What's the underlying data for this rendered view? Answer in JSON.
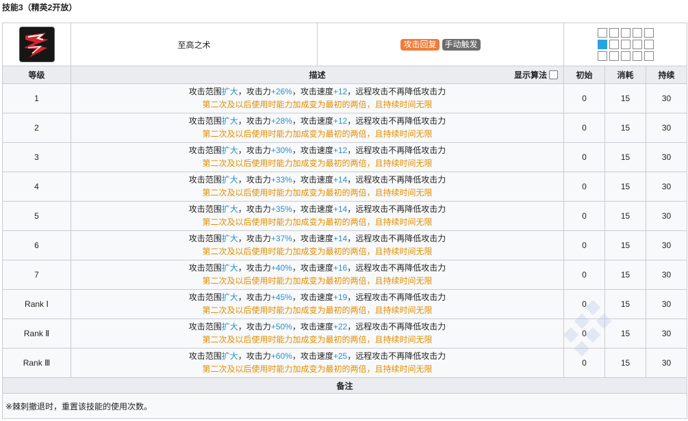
{
  "title": "技能3（精英2开放）",
  "skill": {
    "name": "至高之术",
    "tags": [
      {
        "label": "攻击回复",
        "color": "#f07c3b"
      },
      {
        "label": "手动触发",
        "color": "#6b6b6b"
      }
    ],
    "range_grid": [
      [
        0,
        0,
        0,
        0,
        0
      ],
      [
        1,
        0,
        0,
        0,
        0
      ],
      [
        0,
        0,
        0,
        0,
        0
      ]
    ]
  },
  "columns": {
    "level": "等级",
    "desc": "描述",
    "show_algo": "显示算法",
    "initial": "初始",
    "cost": "消耗",
    "duration": "持续"
  },
  "rows": [
    {
      "level": "1",
      "p1": "攻击范围",
      "p2": "扩大",
      "p3": "，攻击力",
      "p4": "+26%",
      "p5": "，攻击速度",
      "p6": "+12",
      "p7": "，远程攻击不再降低攻击力",
      "line2": "第二次及以后使用时能力加成变为最初的两倍，且持续时间无限",
      "initial": "0",
      "cost": "15",
      "duration": "30"
    },
    {
      "level": "2",
      "p1": "攻击范围",
      "p2": "扩大",
      "p3": "，攻击力",
      "p4": "+28%",
      "p5": "，攻击速度",
      "p6": "+12",
      "p7": "，远程攻击不再降低攻击力",
      "line2": "第二次及以后使用时能力加成变为最初的两倍，且持续时间无限",
      "initial": "0",
      "cost": "15",
      "duration": "30"
    },
    {
      "level": "3",
      "p1": "攻击范围",
      "p2": "扩大",
      "p3": "，攻击力",
      "p4": "+30%",
      "p5": "，攻击速度",
      "p6": "+12",
      "p7": "，远程攻击不再降低攻击力",
      "line2": "第二次及以后使用时能力加成变为最初的两倍，且持续时间无限",
      "initial": "0",
      "cost": "15",
      "duration": "30"
    },
    {
      "level": "4",
      "p1": "攻击范围",
      "p2": "扩大",
      "p3": "，攻击力",
      "p4": "+33%",
      "p5": "，攻击速度",
      "p6": "+14",
      "p7": "，远程攻击不再降低攻击力",
      "line2": "第二次及以后使用时能力加成变为最初的两倍，且持续时间无限",
      "initial": "0",
      "cost": "15",
      "duration": "30"
    },
    {
      "level": "5",
      "p1": "攻击范围",
      "p2": "扩大",
      "p3": "，攻击力",
      "p4": "+35%",
      "p5": "，攻击速度",
      "p6": "+14",
      "p7": "，远程攻击不再降低攻击力",
      "line2": "第二次及以后使用时能力加成变为最初的两倍，且持续时间无限",
      "initial": "0",
      "cost": "15",
      "duration": "30"
    },
    {
      "level": "6",
      "p1": "攻击范围",
      "p2": "扩大",
      "p3": "，攻击力",
      "p4": "+37%",
      "p5": "，攻击速度",
      "p6": "+14",
      "p7": "，远程攻击不再降低攻击力",
      "line2": "第二次及以后使用时能力加成变为最初的两倍，且持续时间无限",
      "initial": "0",
      "cost": "15",
      "duration": "30"
    },
    {
      "level": "7",
      "p1": "攻击范围",
      "p2": "扩大",
      "p3": "，攻击力",
      "p4": "+40%",
      "p5": "，攻击速度",
      "p6": "+16",
      "p7": "，远程攻击不再降低攻击力",
      "line2": "第二次及以后使用时能力加成变为最初的两倍，且持续时间无限",
      "initial": "0",
      "cost": "15",
      "duration": "30"
    },
    {
      "level": "Rank Ⅰ",
      "p1": "攻击范围",
      "p2": "扩大",
      "p3": "，攻击力",
      "p4": "+45%",
      "p5": "，攻击速度",
      "p6": "+19",
      "p7": "，远程攻击不再降低攻击力",
      "line2": "第二次及以后使用时能力加成变为最初的两倍，且持续时间无限",
      "initial": "0",
      "cost": "15",
      "duration": "30"
    },
    {
      "level": "Rank Ⅱ",
      "p1": "攻击范围",
      "p2": "扩大",
      "p3": "，攻击力",
      "p4": "+50%",
      "p5": "，攻击速度",
      "p6": "+22",
      "p7": "，远程攻击不再降低攻击力",
      "line2": "第二次及以后使用时能力加成变为最初的两倍，且持续时间无限",
      "initial": "0",
      "cost": "15",
      "duration": "30"
    },
    {
      "level": "Rank Ⅲ",
      "p1": "攻击范围",
      "p2": "扩大",
      "p3": "，攻击力",
      "p4": "+60%",
      "p5": "，攻击速度",
      "p6": "+25",
      "p7": "，远程攻击不再降低攻击力",
      "line2": "第二次及以后使用时能力加成变为最初的两倍，且持续时间无限",
      "initial": "0",
      "cost": "15",
      "duration": "30"
    }
  ],
  "notes": {
    "header": "备注",
    "text": "※棘刺撤退时，重置该技能的使用次数。"
  },
  "colors": {
    "blue_value": "#2a8fc9",
    "orange_text": "#e08d00",
    "header_bg": "#eaecf0",
    "range_active": "#27a3e3"
  }
}
